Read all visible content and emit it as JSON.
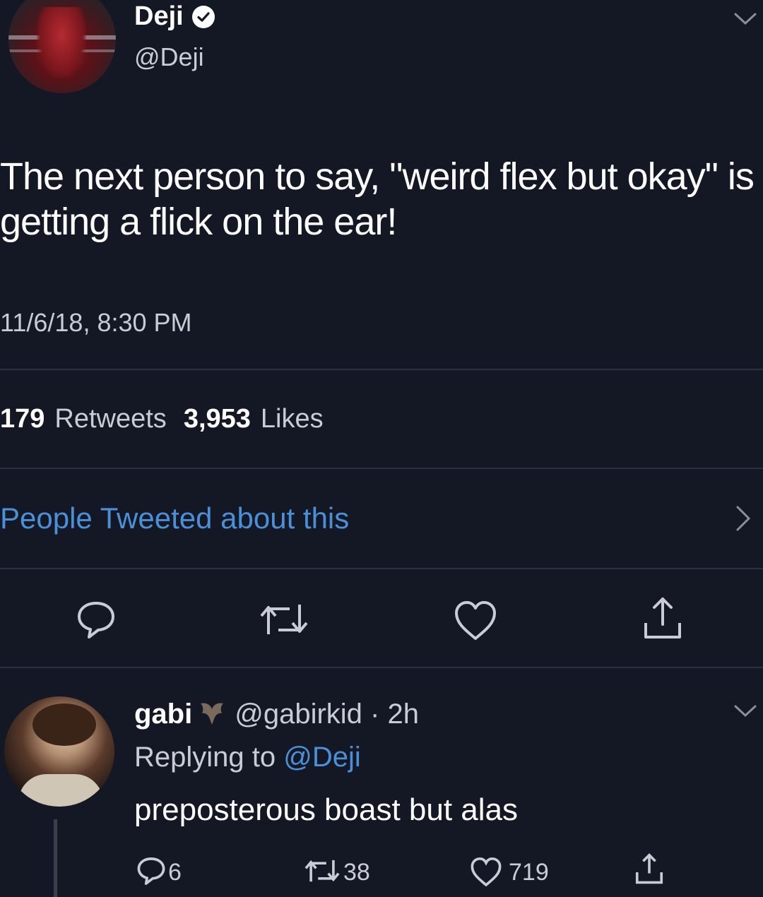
{
  "tweet": {
    "author": {
      "display_name": "Deji",
      "handle": "@Deji",
      "verified": true
    },
    "text": "The next person to say, \"weird flex but okay\" is getting a flick on the ear!",
    "timestamp": "11/6/18, 8:30 PM",
    "stats": {
      "retweets_count": "179",
      "retweets_label": "Retweets",
      "likes_count": "3,953",
      "likes_label": "Likes"
    },
    "people_link": "People Tweeted about this",
    "actions": [
      "reply-icon",
      "retweet-icon",
      "like-icon",
      "share-icon"
    ]
  },
  "reply": {
    "display_name": "gabi",
    "handle_time": "@gabirkid · 2h",
    "replying_prefix": "Replying to",
    "replying_mention": "@Deji",
    "text": "preposterous boast but alas",
    "reply_count": "6",
    "retweet_count": "38",
    "like_count": "719"
  },
  "colors": {
    "background": "#141824",
    "text_primary": "#ffffff",
    "text_secondary": "#c9ccd4",
    "link": "#4a90d9",
    "divider": "#2c3140"
  }
}
